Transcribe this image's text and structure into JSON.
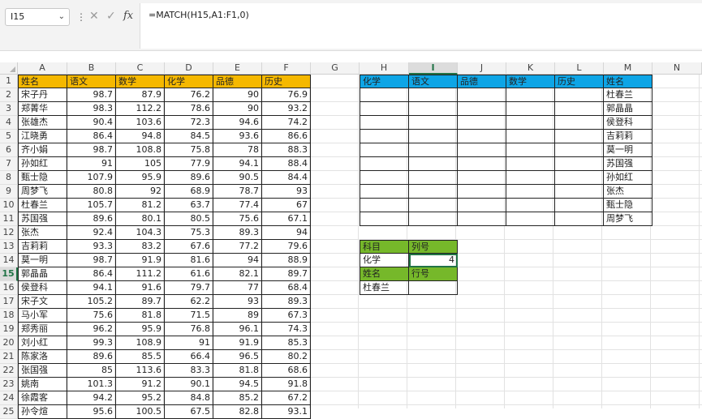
{
  "formula_bar": {
    "name_box": "I15",
    "formula": "=MATCH(H15,A1:F1,0)",
    "cancel_icon": "✕",
    "enter_icon": "✓",
    "fx_label": "fx"
  },
  "columns": [
    "A",
    "B",
    "C",
    "D",
    "E",
    "F",
    "G",
    "H",
    "I",
    "J",
    "K",
    "L",
    "M",
    "N"
  ],
  "selected_column": "I",
  "selected_row": 15,
  "rows": [
    "1",
    "2",
    "3",
    "4",
    "5",
    "6",
    "7",
    "8",
    "9",
    "10",
    "11",
    "12",
    "13",
    "14",
    "15",
    "16",
    "17",
    "18",
    "19",
    "20",
    "21",
    "22",
    "23",
    "24",
    "25"
  ],
  "main_table": {
    "headers": [
      "姓名",
      "语文",
      "数学",
      "化学",
      "品德",
      "历史"
    ],
    "rows": [
      [
        "宋子丹",
        "98.7",
        "87.9",
        "76.2",
        "90",
        "76.9"
      ],
      [
        "郑菁华",
        "98.3",
        "112.2",
        "78.6",
        "90",
        "93.2"
      ],
      [
        "张雄杰",
        "90.4",
        "103.6",
        "72.3",
        "94.6",
        "74.2"
      ],
      [
        "江晓勇",
        "86.4",
        "94.8",
        "84.5",
        "93.6",
        "86.6"
      ],
      [
        "齐小娟",
        "98.7",
        "108.8",
        "75.8",
        "78",
        "88.3"
      ],
      [
        "孙如红",
        "91",
        "105",
        "77.9",
        "94.1",
        "88.4"
      ],
      [
        "甄士隐",
        "107.9",
        "95.9",
        "89.6",
        "90.5",
        "84.4"
      ],
      [
        "周梦飞",
        "80.8",
        "92",
        "68.9",
        "78.7",
        "93"
      ],
      [
        "杜春兰",
        "105.7",
        "81.2",
        "63.7",
        "77.4",
        "67"
      ],
      [
        "苏国强",
        "89.6",
        "80.1",
        "80.5",
        "75.6",
        "67.1"
      ],
      [
        "张杰",
        "92.4",
        "104.3",
        "75.3",
        "89.3",
        "94"
      ],
      [
        "吉莉莉",
        "93.3",
        "83.2",
        "67.6",
        "77.2",
        "79.6"
      ],
      [
        "莫一明",
        "98.7",
        "91.9",
        "81.6",
        "94",
        "88.9"
      ],
      [
        "郭晶晶",
        "86.4",
        "111.2",
        "61.6",
        "82.1",
        "89.7"
      ],
      [
        "侯登科",
        "94.1",
        "91.6",
        "79.7",
        "77",
        "68.4"
      ],
      [
        "宋子文",
        "105.2",
        "89.7",
        "62.2",
        "93",
        "89.3"
      ],
      [
        "马小军",
        "75.6",
        "81.8",
        "71.5",
        "89",
        "67.3"
      ],
      [
        "郑秀丽",
        "96.2",
        "95.9",
        "76.8",
        "96.1",
        "74.3"
      ],
      [
        "刘小红",
        "99.3",
        "108.9",
        "91",
        "91.9",
        "85.3"
      ],
      [
        "陈家洛",
        "89.6",
        "85.5",
        "66.4",
        "96.5",
        "80.2"
      ],
      [
        "张国强",
        "85",
        "113.6",
        "83.3",
        "81.8",
        "68.6"
      ],
      [
        "姚南",
        "101.3",
        "91.2",
        "90.1",
        "94.5",
        "91.8"
      ],
      [
        "徐霞客",
        "94.2",
        "95.2",
        "84.8",
        "85.2",
        "67.2"
      ],
      [
        "孙令煊",
        "95.6",
        "100.5",
        "67.5",
        "82.8",
        "93.1"
      ]
    ]
  },
  "lookup_table": {
    "headers": [
      "化学",
      "语文",
      "品德",
      "数学",
      "历史",
      "姓名"
    ],
    "names": [
      "杜春兰",
      "郭晶晶",
      "侯登科",
      "吉莉莉",
      "莫一明",
      "苏国强",
      "孙如红",
      "张杰",
      "甄士隐",
      "周梦飞"
    ]
  },
  "helper": {
    "subject_label": "科目",
    "col_no_label": "列号",
    "subject_value": "化学",
    "col_no_value": "4",
    "name_label": "姓名",
    "row_no_label": "行号",
    "name_value": "杜春兰",
    "row_no_value": ""
  },
  "colors": {
    "orange_header": "#f5b800",
    "blue_header": "#0ea5e6",
    "green_header": "#76b82a",
    "selection": "#217346"
  }
}
